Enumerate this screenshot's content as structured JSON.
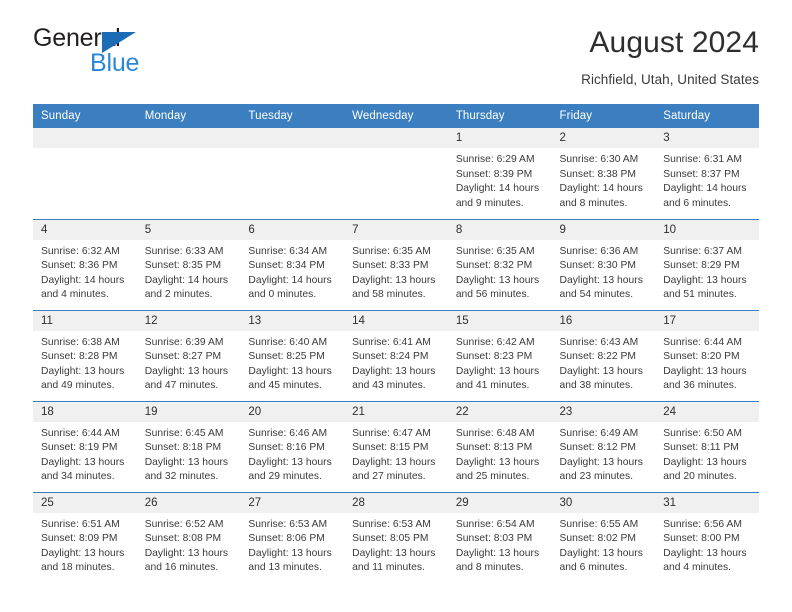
{
  "brand": {
    "name_part1": "General",
    "name_part2": "Blue",
    "accent_color": "#2a87d8",
    "triangle_color": "#1b6cb5"
  },
  "header": {
    "title": "August 2024",
    "location": "Richfield, Utah, United States"
  },
  "calendar": {
    "header_bg": "#3b7fc0",
    "daynum_bg": "#f0f0f0",
    "weekdays": [
      "Sunday",
      "Monday",
      "Tuesday",
      "Wednesday",
      "Thursday",
      "Friday",
      "Saturday"
    ],
    "weeks": [
      [
        {
          "day": "",
          "lines": []
        },
        {
          "day": "",
          "lines": []
        },
        {
          "day": "",
          "lines": []
        },
        {
          "day": "",
          "lines": []
        },
        {
          "day": "1",
          "lines": [
            "Sunrise: 6:29 AM",
            "Sunset: 8:39 PM",
            "Daylight: 14 hours",
            "and 9 minutes."
          ]
        },
        {
          "day": "2",
          "lines": [
            "Sunrise: 6:30 AM",
            "Sunset: 8:38 PM",
            "Daylight: 14 hours",
            "and 8 minutes."
          ]
        },
        {
          "day": "3",
          "lines": [
            "Sunrise: 6:31 AM",
            "Sunset: 8:37 PM",
            "Daylight: 14 hours",
            "and 6 minutes."
          ]
        }
      ],
      [
        {
          "day": "4",
          "lines": [
            "Sunrise: 6:32 AM",
            "Sunset: 8:36 PM",
            "Daylight: 14 hours",
            "and 4 minutes."
          ]
        },
        {
          "day": "5",
          "lines": [
            "Sunrise: 6:33 AM",
            "Sunset: 8:35 PM",
            "Daylight: 14 hours",
            "and 2 minutes."
          ]
        },
        {
          "day": "6",
          "lines": [
            "Sunrise: 6:34 AM",
            "Sunset: 8:34 PM",
            "Daylight: 14 hours",
            "and 0 minutes."
          ]
        },
        {
          "day": "7",
          "lines": [
            "Sunrise: 6:35 AM",
            "Sunset: 8:33 PM",
            "Daylight: 13 hours",
            "and 58 minutes."
          ]
        },
        {
          "day": "8",
          "lines": [
            "Sunrise: 6:35 AM",
            "Sunset: 8:32 PM",
            "Daylight: 13 hours",
            "and 56 minutes."
          ]
        },
        {
          "day": "9",
          "lines": [
            "Sunrise: 6:36 AM",
            "Sunset: 8:30 PM",
            "Daylight: 13 hours",
            "and 54 minutes."
          ]
        },
        {
          "day": "10",
          "lines": [
            "Sunrise: 6:37 AM",
            "Sunset: 8:29 PM",
            "Daylight: 13 hours",
            "and 51 minutes."
          ]
        }
      ],
      [
        {
          "day": "11",
          "lines": [
            "Sunrise: 6:38 AM",
            "Sunset: 8:28 PM",
            "Daylight: 13 hours",
            "and 49 minutes."
          ]
        },
        {
          "day": "12",
          "lines": [
            "Sunrise: 6:39 AM",
            "Sunset: 8:27 PM",
            "Daylight: 13 hours",
            "and 47 minutes."
          ]
        },
        {
          "day": "13",
          "lines": [
            "Sunrise: 6:40 AM",
            "Sunset: 8:25 PM",
            "Daylight: 13 hours",
            "and 45 minutes."
          ]
        },
        {
          "day": "14",
          "lines": [
            "Sunrise: 6:41 AM",
            "Sunset: 8:24 PM",
            "Daylight: 13 hours",
            "and 43 minutes."
          ]
        },
        {
          "day": "15",
          "lines": [
            "Sunrise: 6:42 AM",
            "Sunset: 8:23 PM",
            "Daylight: 13 hours",
            "and 41 minutes."
          ]
        },
        {
          "day": "16",
          "lines": [
            "Sunrise: 6:43 AM",
            "Sunset: 8:22 PM",
            "Daylight: 13 hours",
            "and 38 minutes."
          ]
        },
        {
          "day": "17",
          "lines": [
            "Sunrise: 6:44 AM",
            "Sunset: 8:20 PM",
            "Daylight: 13 hours",
            "and 36 minutes."
          ]
        }
      ],
      [
        {
          "day": "18",
          "lines": [
            "Sunrise: 6:44 AM",
            "Sunset: 8:19 PM",
            "Daylight: 13 hours",
            "and 34 minutes."
          ]
        },
        {
          "day": "19",
          "lines": [
            "Sunrise: 6:45 AM",
            "Sunset: 8:18 PM",
            "Daylight: 13 hours",
            "and 32 minutes."
          ]
        },
        {
          "day": "20",
          "lines": [
            "Sunrise: 6:46 AM",
            "Sunset: 8:16 PM",
            "Daylight: 13 hours",
            "and 29 minutes."
          ]
        },
        {
          "day": "21",
          "lines": [
            "Sunrise: 6:47 AM",
            "Sunset: 8:15 PM",
            "Daylight: 13 hours",
            "and 27 minutes."
          ]
        },
        {
          "day": "22",
          "lines": [
            "Sunrise: 6:48 AM",
            "Sunset: 8:13 PM",
            "Daylight: 13 hours",
            "and 25 minutes."
          ]
        },
        {
          "day": "23",
          "lines": [
            "Sunrise: 6:49 AM",
            "Sunset: 8:12 PM",
            "Daylight: 13 hours",
            "and 23 minutes."
          ]
        },
        {
          "day": "24",
          "lines": [
            "Sunrise: 6:50 AM",
            "Sunset: 8:11 PM",
            "Daylight: 13 hours",
            "and 20 minutes."
          ]
        }
      ],
      [
        {
          "day": "25",
          "lines": [
            "Sunrise: 6:51 AM",
            "Sunset: 8:09 PM",
            "Daylight: 13 hours",
            "and 18 minutes."
          ]
        },
        {
          "day": "26",
          "lines": [
            "Sunrise: 6:52 AM",
            "Sunset: 8:08 PM",
            "Daylight: 13 hours",
            "and 16 minutes."
          ]
        },
        {
          "day": "27",
          "lines": [
            "Sunrise: 6:53 AM",
            "Sunset: 8:06 PM",
            "Daylight: 13 hours",
            "and 13 minutes."
          ]
        },
        {
          "day": "28",
          "lines": [
            "Sunrise: 6:53 AM",
            "Sunset: 8:05 PM",
            "Daylight: 13 hours",
            "and 11 minutes."
          ]
        },
        {
          "day": "29",
          "lines": [
            "Sunrise: 6:54 AM",
            "Sunset: 8:03 PM",
            "Daylight: 13 hours",
            "and 8 minutes."
          ]
        },
        {
          "day": "30",
          "lines": [
            "Sunrise: 6:55 AM",
            "Sunset: 8:02 PM",
            "Daylight: 13 hours",
            "and 6 minutes."
          ]
        },
        {
          "day": "31",
          "lines": [
            "Sunrise: 6:56 AM",
            "Sunset: 8:00 PM",
            "Daylight: 13 hours",
            "and 4 minutes."
          ]
        }
      ]
    ]
  }
}
